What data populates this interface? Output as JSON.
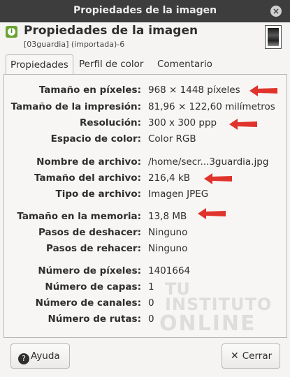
{
  "window": {
    "title": "Propiedades de la imagen",
    "close_icon": "close-icon"
  },
  "header": {
    "title": "Propiedades de la imagen",
    "subtitle": "[03guardia] (importada)-6"
  },
  "tabs": [
    {
      "label": "Propiedades"
    },
    {
      "label": "Perfil de color"
    },
    {
      "label": "Comentario"
    }
  ],
  "properties": [
    {
      "label": "Tamaño en píxeles:",
      "value": "968 × 1448 píxeles"
    },
    {
      "label": "Tamaño de la impresión:",
      "value": "81,96 × 122,60 milímetros"
    },
    {
      "label": "Resolución:",
      "value": "300 x 300 ppp"
    },
    {
      "label": "Espacio de color:",
      "value": "Color RGB"
    },
    {
      "label": "Nombre de archivo:",
      "value": "/home/secr...3guardia.jpg"
    },
    {
      "label": "Tamaño del archivo:",
      "value": "216,4 kB"
    },
    {
      "label": "Tipo de archivo:",
      "value": "Imagen JPEG"
    },
    {
      "label": "Tamaño en la memoria:",
      "value": "13,8 MB"
    },
    {
      "label": "Pasos de deshacer:",
      "value": "Ninguno"
    },
    {
      "label": "Pasos de rehacer:",
      "value": "Ninguno"
    },
    {
      "label": "Número de píxeles:",
      "value": "1401664"
    },
    {
      "label": "Número de capas:",
      "value": "1"
    },
    {
      "label": "Número de canales:",
      "value": "0"
    },
    {
      "label": "Número de rutas:",
      "value": "0"
    }
  ],
  "watermark": {
    "line1": "TU",
    "line2": "INSTITUTO",
    "line3": "ONLINE"
  },
  "footer": {
    "help_label": "Ayuda",
    "close_label": "Cerrar"
  },
  "colors": {
    "arrow": "#e0332b",
    "titlebar": "#3d3d3d",
    "info_icon": "#6aa333"
  }
}
